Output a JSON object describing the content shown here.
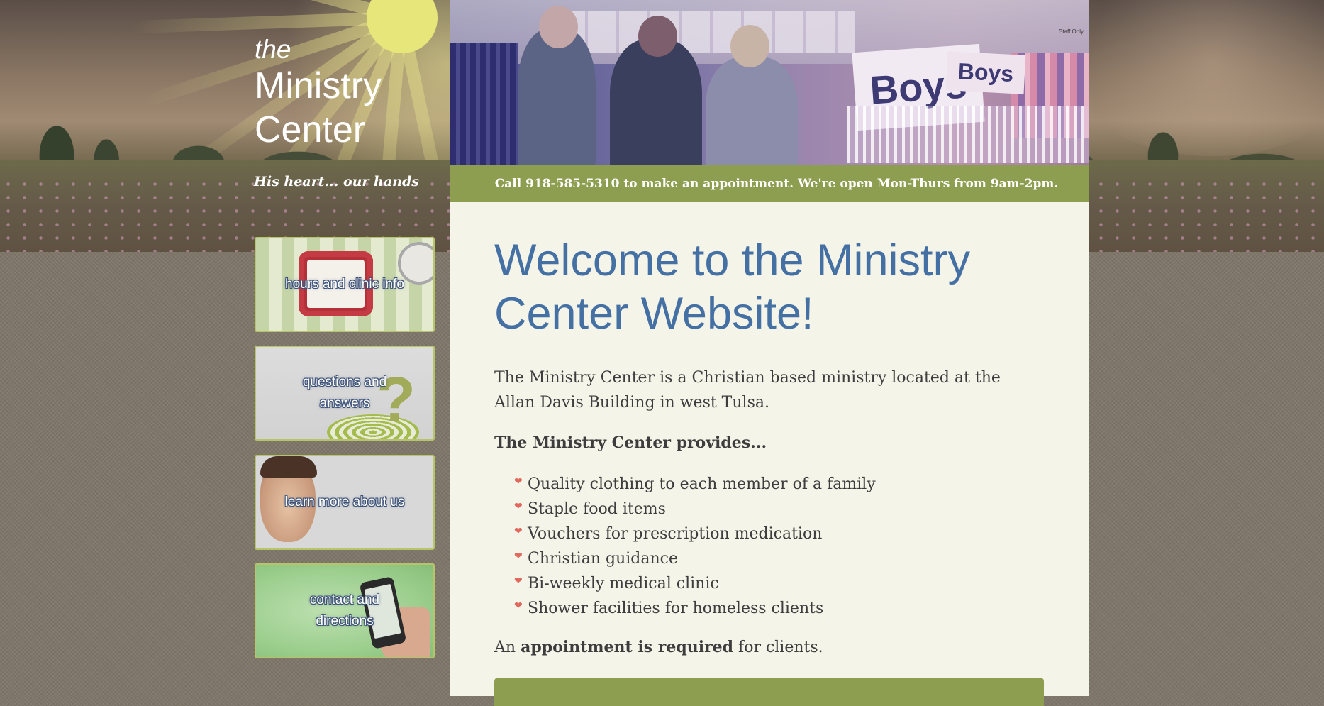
{
  "site": {
    "brand_the": "the",
    "brand_name": "Ministry Center",
    "tagline": "His heart... our hands"
  },
  "header": {
    "sign_large": "Boys",
    "sign_small": "Boys",
    "staff_only": "Staff Only",
    "info_bar": "Call 918-585-5310 to make an appointment. We're open Mon-Thurs from 9am-2pm."
  },
  "sidebar": {
    "items": [
      {
        "label": "hours and clinic info",
        "icon": "clock-icon"
      },
      {
        "label": "questions and answers",
        "icon": "question-mark-icon"
      },
      {
        "label": "learn more about us",
        "icon": "person-photo"
      },
      {
        "label": "contact and directions",
        "icon": "phone-icon"
      }
    ]
  },
  "main": {
    "title": "Welcome to the Ministry Center Website!",
    "intro": "The Ministry Center is a Christian based ministry located at the Allan Davis Building in west Tulsa.",
    "provides_heading": "The Ministry Center provides...",
    "bullet_icon": "heart-icon",
    "provides_list": [
      "Quality clothing to each member of a family",
      "Staple food items",
      "Vouchers for prescription medication",
      "Christian guidance",
      "Bi-weekly medical clinic",
      "Shower facilities for homeless clients"
    ],
    "appointment_prefix": "An ",
    "appointment_bold": "appointment is required",
    "appointment_suffix": " for clients."
  },
  "colors": {
    "accent_green": "#8d9e51",
    "title_blue": "#4570a4",
    "content_bg": "#f4f4e9",
    "bullet_heart": "#e2685d",
    "page_bg": "#7f7669"
  }
}
